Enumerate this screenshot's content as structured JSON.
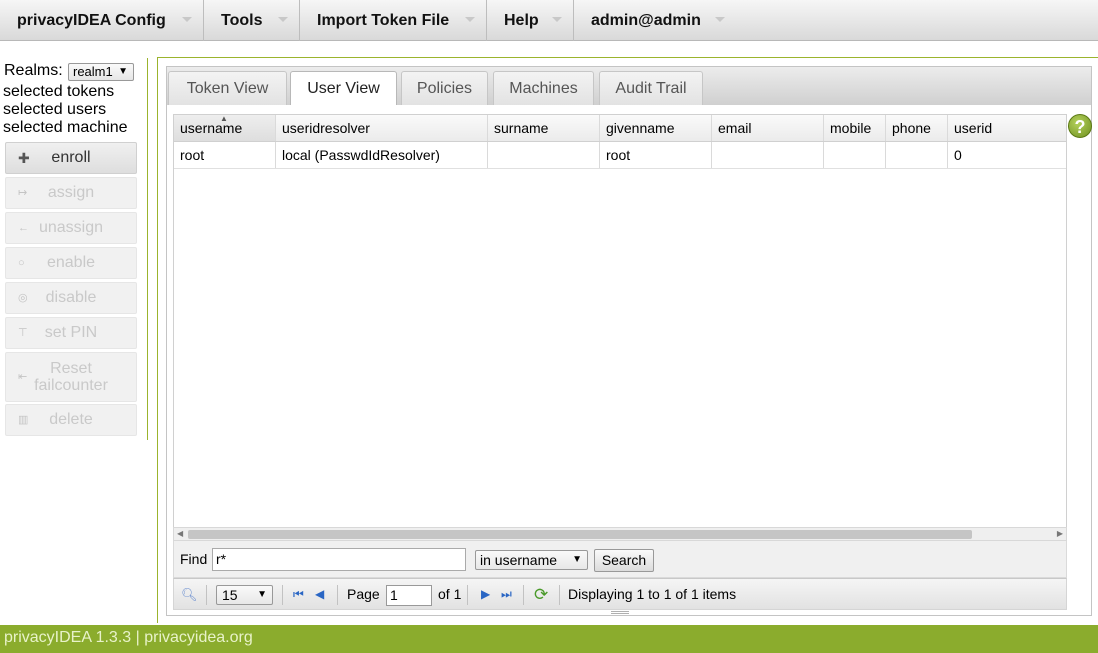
{
  "menu": {
    "config": "privacyIDEA Config",
    "tools": "Tools",
    "import": "Import Token File",
    "help": "Help",
    "user": "admin@admin"
  },
  "sidebar": {
    "realms_label": "Realms:",
    "realm_selected": "realm1",
    "selected_tokens": "selected tokens",
    "selected_users": "selected users",
    "selected_machine": "selected machine",
    "buttons": {
      "enroll": "enroll",
      "assign": "assign",
      "unassign": "unassign",
      "enable": "enable",
      "disable": "disable",
      "set_pin": "set PIN",
      "reset_1": "Reset",
      "reset_2": "failcounter",
      "delete": "delete"
    }
  },
  "tabs": {
    "token_view": "Token View",
    "user_view": "User View",
    "policies": "Policies",
    "machines": "Machines",
    "audit_trail": "Audit Trail"
  },
  "grid": {
    "columns": {
      "username": "username",
      "useridresolver": "useridresolver",
      "surname": "surname",
      "givenname": "givenname",
      "email": "email",
      "mobile": "mobile",
      "phone": "phone",
      "userid": "userid"
    },
    "rows": [
      {
        "username": "root",
        "useridresolver": "local (PasswdIdResolver)",
        "surname": "",
        "givenname": "root",
        "email": "",
        "mobile": "",
        "phone": "",
        "userid": "0"
      }
    ]
  },
  "find": {
    "label": "Find",
    "value": "r*",
    "field": "in username",
    "search_label": "Search"
  },
  "pager": {
    "per_page": "15",
    "page_label": "Page",
    "page_value": "1",
    "of_label": "of 1",
    "status": "Displaying 1 to 1 of 1 items"
  },
  "footer": {
    "text": "privacyIDEA 1.3.3 | privacyidea.org"
  },
  "colors": {
    "accent_green": "#8bac2d",
    "link_blue": "#2a66c4"
  }
}
